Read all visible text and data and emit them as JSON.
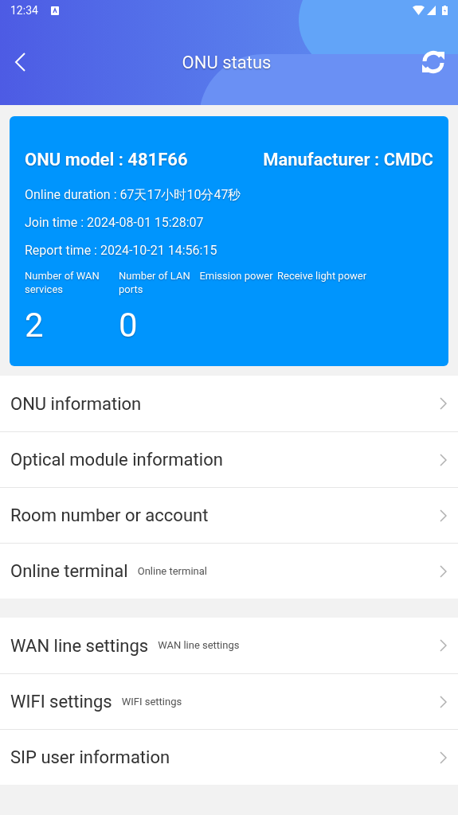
{
  "status_bar": {
    "time": "12:34"
  },
  "header": {
    "title": "ONU status"
  },
  "card": {
    "model": "ONU model : 481F66",
    "manufacturer": "Manufacturer : CMDC",
    "lines": [
      "Online duration : 67天17小时10分47秒",
      "Join time : 2024-08-01 15:28:07",
      "Report time : 2024-10-21 14:56:15"
    ],
    "stats": [
      {
        "label": "Number of WAN services",
        "value": "2"
      },
      {
        "label": "Number of LAN ports",
        "value": "0"
      },
      {
        "label": "Emission power"
      },
      {
        "label": "Receive light power"
      }
    ]
  },
  "sections": [
    [
      {
        "title": "ONU information"
      },
      {
        "title": "Optical module information"
      },
      {
        "title": "Room number or account"
      },
      {
        "title": "Online terminal",
        "subtitle": "Online terminal"
      }
    ],
    [
      {
        "title": "WAN line settings",
        "subtitle": "WAN line settings"
      },
      {
        "title": "WIFI settings",
        "subtitle": "WIFI settings"
      },
      {
        "title": "SIP user information"
      }
    ]
  ]
}
